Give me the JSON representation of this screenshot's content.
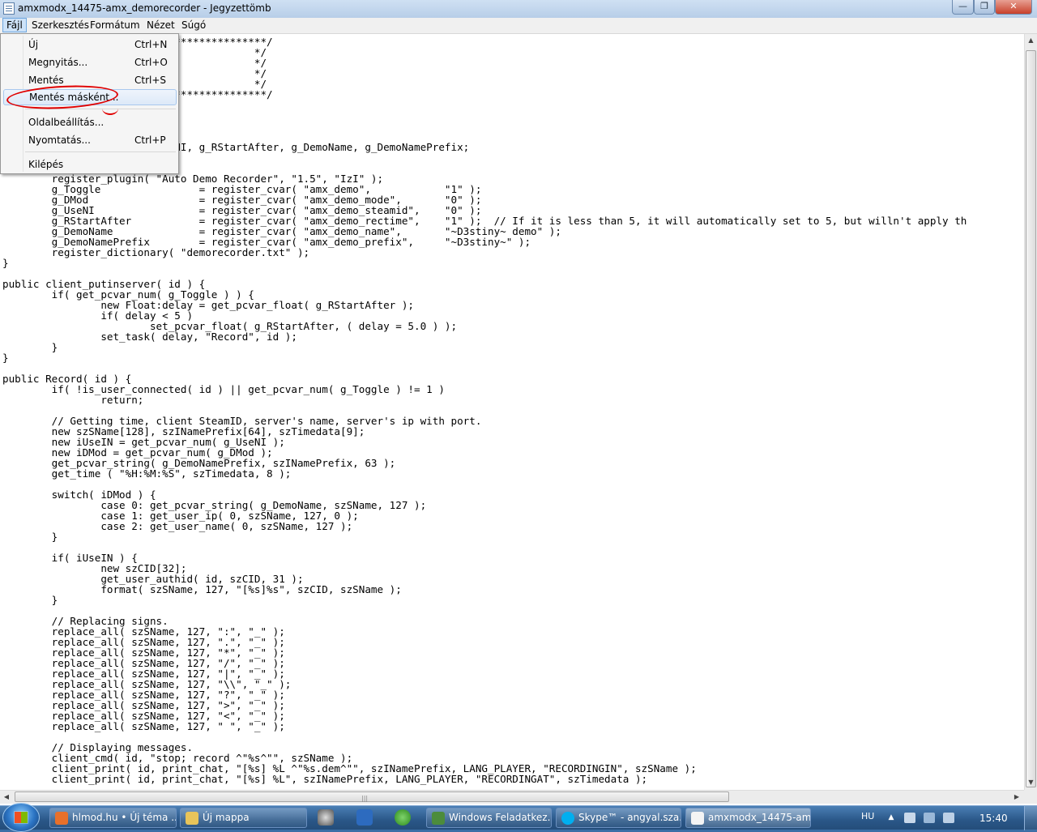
{
  "window": {
    "title": "amxmodx_14475-amx_demorecorder - Jegyzettömb",
    "min_glyph": "—",
    "max_glyph": "❐",
    "close_glyph": "✕"
  },
  "menubar": [
    {
      "label": "Fájl"
    },
    {
      "label": "Szerkesztés"
    },
    {
      "label": "Formátum"
    },
    {
      "label": "Nézet"
    },
    {
      "label": "Súgó"
    }
  ],
  "file_menu": [
    {
      "label": "Új",
      "shortcut": "Ctrl+N"
    },
    {
      "label": "Megnyitás...",
      "shortcut": "Ctrl+O"
    },
    {
      "label": "Mentés",
      "shortcut": "Ctrl+S"
    },
    {
      "label": "Mentés másként...",
      "shortcut": ""
    },
    {
      "label": "Oldalbeállítás...",
      "shortcut": ""
    },
    {
      "label": "Nyomtatás...",
      "shortcut": "Ctrl+P"
    },
    {
      "label": "Kilépés",
      "shortcut": ""
    }
  ],
  "editor": {
    "text": "                           ****************/\n                                         */\n                                         */\n                                         */\n                                         */\n                            ***************/\n\n\n\n\n                            NI, g_RStartAfter, g_DemoName, g_DemoNamePrefix;\n\n\n        register_plugin( \"Auto Demo Recorder\", \"1.5\", \"IzI\" );\n        g_Toggle                = register_cvar( \"amx_demo\",            \"1\" );\n        g_DMod                  = register_cvar( \"amx_demo_mode\",       \"0\" );\n        g_UseNI                 = register_cvar( \"amx_demo_steamid\",    \"0\" );\n        g_RStartAfter           = register_cvar( \"amx_demo_rectime\",    \"1\" );  // If it is less than 5, it will automatically set to 5, but willn't apply th\n        g_DemoName              = register_cvar( \"amx_demo_name\",       \"~D3stiny~ demo\" );\n        g_DemoNamePrefix        = register_cvar( \"amx_demo_prefix\",     \"~D3stiny~\" );\n        register_dictionary( \"demorecorder.txt\" );\n}\n\npublic client_putinserver( id ) {\n        if( get_pcvar_num( g_Toggle ) ) {\n                new Float:delay = get_pcvar_float( g_RStartAfter );\n                if( delay < 5 )\n                        set_pcvar_float( g_RStartAfter, ( delay = 5.0 ) );\n                set_task( delay, \"Record\", id );\n        }\n}\n\npublic Record( id ) {\n        if( !is_user_connected( id ) || get_pcvar_num( g_Toggle ) != 1 )\n                return;\n\n        // Getting time, client SteamID, server's name, server's ip with port.\n        new szSName[128], szINamePrefix[64], szTimedata[9];\n        new iUseIN = get_pcvar_num( g_UseNI );\n        new iDMod = get_pcvar_num( g_DMod );\n        get_pcvar_string( g_DemoNamePrefix, szINamePrefix, 63 );\n        get_time ( \"%H:%M:%S\", szTimedata, 8 );\n\n        switch( iDMod ) {\n                case 0: get_pcvar_string( g_DemoName, szSName, 127 );\n                case 1: get_user_ip( 0, szSName, 127, 0 );\n                case 2: get_user_name( 0, szSName, 127 );\n        }\n\n        if( iUseIN ) {\n                new szCID[32];\n                get_user_authid( id, szCID, 31 );\n                format( szSName, 127, \"[%s]%s\", szCID, szSName );\n        }\n\n        // Replacing signs.\n        replace_all( szSName, 127, \":\", \"_\" );\n        replace_all( szSName, 127, \".\", \"_\" );\n        replace_all( szSName, 127, \"*\", \"_\" );\n        replace_all( szSName, 127, \"/\", \"_\" );\n        replace_all( szSName, 127, \"|\", \"_\" );\n        replace_all( szSName, 127, \"\\\\\", \"_\" );\n        replace_all( szSName, 127, \"?\", \"_\" );\n        replace_all( szSName, 127, \">\", \"_\" );\n        replace_all( szSName, 127, \"<\", \"_\" );\n        replace_all( szSName, 127, \" \", \"_\" );\n\n        // Displaying messages.\n        client_cmd( id, \"stop; record ^\"%s^\"\", szSName );\n        client_print( id, print_chat, \"[%s] %L ^\"%s.dem^\"\", szINamePrefix, LANG_PLAYER, \"RECORDINGIN\", szSName );\n        client_print( id, print_chat, \"[%s] %L\", szINamePrefix, LANG_PLAYER, \"RECORDINGAT\", szTimedata );"
  },
  "scrollbars": {
    "up": "▲",
    "down": "▼",
    "left": "◀",
    "right": "▶",
    "grip": "|||"
  },
  "taskbar": {
    "tasks": [
      {
        "label": "hlmod.hu • Új téma ...",
        "color": "#e8702a"
      },
      {
        "label": "Új mappa",
        "color": "#e8c45a"
      },
      {
        "label": "Windows Feladatkez...",
        "color": "#4c8c3c"
      },
      {
        "label": "Skype™ - angyal.sza...",
        "color": "#00aff0"
      },
      {
        "label": "amxmodx_14475-am...",
        "color": "#f4f4f4"
      }
    ],
    "language": "HU",
    "tray_up": "▲",
    "clock": "15:40"
  },
  "colors": {
    "annotation_circle": "#e00000",
    "titlebar": "#b7cee8",
    "taskbar": "#2a5788"
  }
}
